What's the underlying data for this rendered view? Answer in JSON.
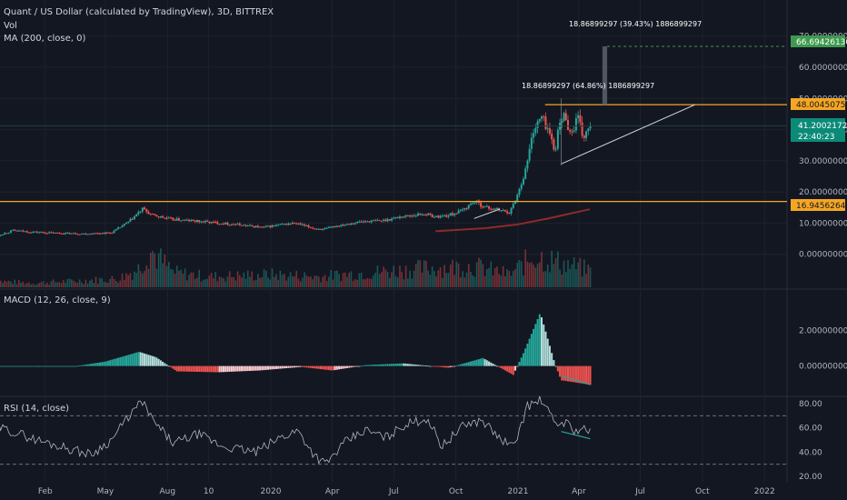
{
  "header": {
    "title": "Quant / US Dollar (calculated by TradingView), 3D, BITTREX",
    "vol_label": "Vol",
    "ma_label": "MA (200, close, 0)"
  },
  "macd_header": "MACD (12, 26, close, 9)",
  "rsi_header": "RSI (14, close)",
  "annotations": {
    "range1": "18.86899297 (64.86%) 1886899297",
    "range2": "18.86899297 (39.43%) 1886899297"
  },
  "price_labels": {
    "target": "66.69426130",
    "resistance": "48.00450758",
    "current": "41.20021724",
    "countdown": "22:40:23",
    "support": "16.94562645"
  },
  "colors": {
    "background": "#131722",
    "up": "#26a69a",
    "down": "#ef5350",
    "ma": "#8e2a2a",
    "orange": "#f5a623",
    "target": "#3e9a4e",
    "current": "#0b8a78",
    "trendline": "#d1d4dc",
    "divergence": "#26a69a"
  },
  "chart_data": [
    {
      "type": "candlestick",
      "title": "Quant / US Dollar (calculated by TradingView), 3D, BITTREX",
      "y_ticks": [
        "70.00000000",
        "60.00000000",
        "50.00000000",
        "40.00000000",
        "30.00000000",
        "20.00000000",
        "10.00000000",
        "0.00000000"
      ],
      "ylim": [
        -3,
        74
      ],
      "x_labels": [
        "Feb",
        "May",
        "Aug",
        "10",
        "2020",
        "Apr",
        "Jul",
        "Oct",
        "2021",
        "Apr",
        "Jul",
        "Oct",
        "2022"
      ],
      "x_label_dates": [
        "2019-02-01",
        "2019-05-01",
        "2019-08-01",
        "2019-10-01",
        "2020-01-01",
        "2020-04-01",
        "2020-07-01",
        "2020-10-01",
        "2021-01-01",
        "2021-04-01",
        "2021-07-01",
        "2021-10-01",
        "2022-01-01"
      ],
      "close_anchors": [
        [
          "2018-11-15",
          5.5
        ],
        [
          "2018-12-15",
          7.6
        ],
        [
          "2019-01-10",
          7.2
        ],
        [
          "2019-02-15",
          6.8
        ],
        [
          "2019-04-01",
          6.6
        ],
        [
          "2019-05-10",
          6.9
        ],
        [
          "2019-06-05",
          10.5
        ],
        [
          "2019-06-25",
          14.5
        ],
        [
          "2019-07-10",
          12.5
        ],
        [
          "2019-08-05",
          11.3
        ],
        [
          "2019-09-01",
          10.8
        ],
        [
          "2019-10-01",
          10.3
        ],
        [
          "2019-11-10",
          9.6
        ],
        [
          "2019-12-20",
          8.6
        ],
        [
          "2020-01-10",
          9.3
        ],
        [
          "2020-02-05",
          10.0
        ],
        [
          "2020-03-05",
          8.3
        ],
        [
          "2020-03-20",
          8.0
        ],
        [
          "2020-04-15",
          9.5
        ],
        [
          "2020-05-15",
          10.5
        ],
        [
          "2020-06-15",
          10.8
        ],
        [
          "2020-07-10",
          12.0
        ],
        [
          "2020-08-15",
          13.0
        ],
        [
          "2020-09-01",
          12.0
        ],
        [
          "2020-09-20",
          12.5
        ],
        [
          "2020-10-10",
          14.0
        ],
        [
          "2020-10-28",
          17.0
        ],
        [
          "2020-11-15",
          15.0
        ],
        [
          "2020-12-05",
          14.2
        ],
        [
          "2020-12-20",
          13.5
        ],
        [
          "2020-12-31",
          19.0
        ],
        [
          "2021-01-12",
          27.0
        ],
        [
          "2021-01-24",
          40.0
        ],
        [
          "2021-02-05",
          44.0
        ],
        [
          "2021-02-15",
          40.0
        ],
        [
          "2021-02-24",
          33.0
        ],
        [
          "2021-03-04",
          42.0
        ],
        [
          "2021-03-12",
          45.0
        ],
        [
          "2021-03-20",
          38.0
        ],
        [
          "2021-03-30",
          44.0
        ],
        [
          "2021-04-08",
          37.0
        ],
        [
          "2021-04-18",
          41.2
        ]
      ],
      "ma200": [
        [
          "2020-09-01",
          7.4
        ],
        [
          "2020-11-15",
          8.4
        ],
        [
          "2021-01-01",
          9.6
        ],
        [
          "2021-02-15",
          11.5
        ],
        [
          "2021-04-18",
          14.5
        ]
      ],
      "volume_peaks": [
        [
          "2018-11-15",
          0.15
        ],
        [
          "2019-01-15",
          0.1
        ],
        [
          "2019-05-20",
          0.2
        ],
        [
          "2019-06-20",
          0.45
        ],
        [
          "2019-07-05",
          0.9
        ],
        [
          "2019-08-10",
          0.35
        ],
        [
          "2019-10-01",
          0.25
        ],
        [
          "2020-01-01",
          0.3
        ],
        [
          "2020-03-15",
          0.25
        ],
        [
          "2020-04-15",
          0.3
        ],
        [
          "2020-08-20",
          0.45
        ],
        [
          "2020-10-28",
          0.5
        ],
        [
          "2020-12-20",
          0.3
        ],
        [
          "2021-01-25",
          0.75
        ],
        [
          "2021-03-10",
          0.55
        ],
        [
          "2021-04-18",
          0.4
        ]
      ],
      "trendline": [
        [
          "2021-03-06",
          29.0
        ],
        [
          "2021-04-18",
          34.5
        ],
        [
          "2021-09-20",
          48.0
        ]
      ],
      "resistance_line": 48.0,
      "support_line": 16.95,
      "target_line": 66.7,
      "current_line": 41.2,
      "target_box": [
        [
          "2021-05-06",
          48.0
        ],
        [
          "2021-05-13",
          66.7
        ]
      ]
    },
    {
      "type": "bar",
      "name": "MACD histogram",
      "y_ticks": [
        "2.00000000",
        "0.00000000"
      ],
      "ylim": [
        -1.5,
        3.3
      ],
      "histogram": [
        [
          "2018-11-15",
          0.0
        ],
        [
          "2019-03-20",
          0.0
        ],
        [
          "2019-05-01",
          0.25
        ],
        [
          "2019-06-20",
          0.8
        ],
        [
          "2019-07-15",
          0.5
        ],
        [
          "2019-08-15",
          -0.3
        ],
        [
          "2019-10-15",
          -0.35
        ],
        [
          "2019-12-15",
          -0.25
        ],
        [
          "2020-02-15",
          -0.05
        ],
        [
          "2020-04-01",
          -0.25
        ],
        [
          "2020-05-20",
          0.05
        ],
        [
          "2020-07-15",
          0.15
        ],
        [
          "2020-09-20",
          -0.1
        ],
        [
          "2020-11-10",
          0.45
        ],
        [
          "2020-12-25",
          -0.5
        ],
        [
          "2021-01-10",
          0.8
        ],
        [
          "2021-02-03",
          3.0
        ],
        [
          "2021-02-24",
          0.2
        ],
        [
          "2021-03-06",
          -0.8
        ],
        [
          "2021-04-18",
          -1.05
        ]
      ],
      "divergence_line": [
        [
          "2021-03-06",
          -0.55
        ],
        [
          "2021-04-18",
          -1.05
        ]
      ]
    },
    {
      "type": "line",
      "name": "RSI (14, close)",
      "y_ticks": [
        "80.00",
        "60.00",
        "40.00",
        "20.00"
      ],
      "ylim": [
        17,
        86
      ],
      "levels": [
        70,
        30
      ],
      "values": [
        [
          "2018-11-15",
          62
        ],
        [
          "2018-12-20",
          56
        ],
        [
          "2019-01-20",
          50
        ],
        [
          "2019-03-01",
          44
        ],
        [
          "2019-04-10",
          38
        ],
        [
          "2019-05-10",
          50
        ],
        [
          "2019-06-05",
          70
        ],
        [
          "2019-06-25",
          82
        ],
        [
          "2019-07-10",
          66
        ],
        [
          "2019-08-10",
          47
        ],
        [
          "2019-09-15",
          55
        ],
        [
          "2019-10-20",
          45
        ],
        [
          "2019-12-10",
          40
        ],
        [
          "2020-01-15",
          52
        ],
        [
          "2020-02-10",
          58
        ],
        [
          "2020-03-05",
          38
        ],
        [
          "2020-03-22",
          30
        ],
        [
          "2020-04-20",
          48
        ],
        [
          "2020-05-20",
          58
        ],
        [
          "2020-06-20",
          52
        ],
        [
          "2020-07-15",
          62
        ],
        [
          "2020-08-20",
          68
        ],
        [
          "2020-09-10",
          45
        ],
        [
          "2020-10-15",
          63
        ],
        [
          "2020-11-10",
          66
        ],
        [
          "2020-12-05",
          51
        ],
        [
          "2020-12-25",
          44
        ],
        [
          "2021-01-15",
          78
        ],
        [
          "2021-02-05",
          83
        ],
        [
          "2021-02-25",
          63
        ],
        [
          "2021-03-12",
          65
        ],
        [
          "2021-03-28",
          57
        ],
        [
          "2021-04-05",
          60
        ],
        [
          "2021-04-18",
          56
        ]
      ],
      "divergence_line": [
        [
          "2021-03-06",
          57
        ],
        [
          "2021-04-18",
          51
        ]
      ]
    }
  ]
}
